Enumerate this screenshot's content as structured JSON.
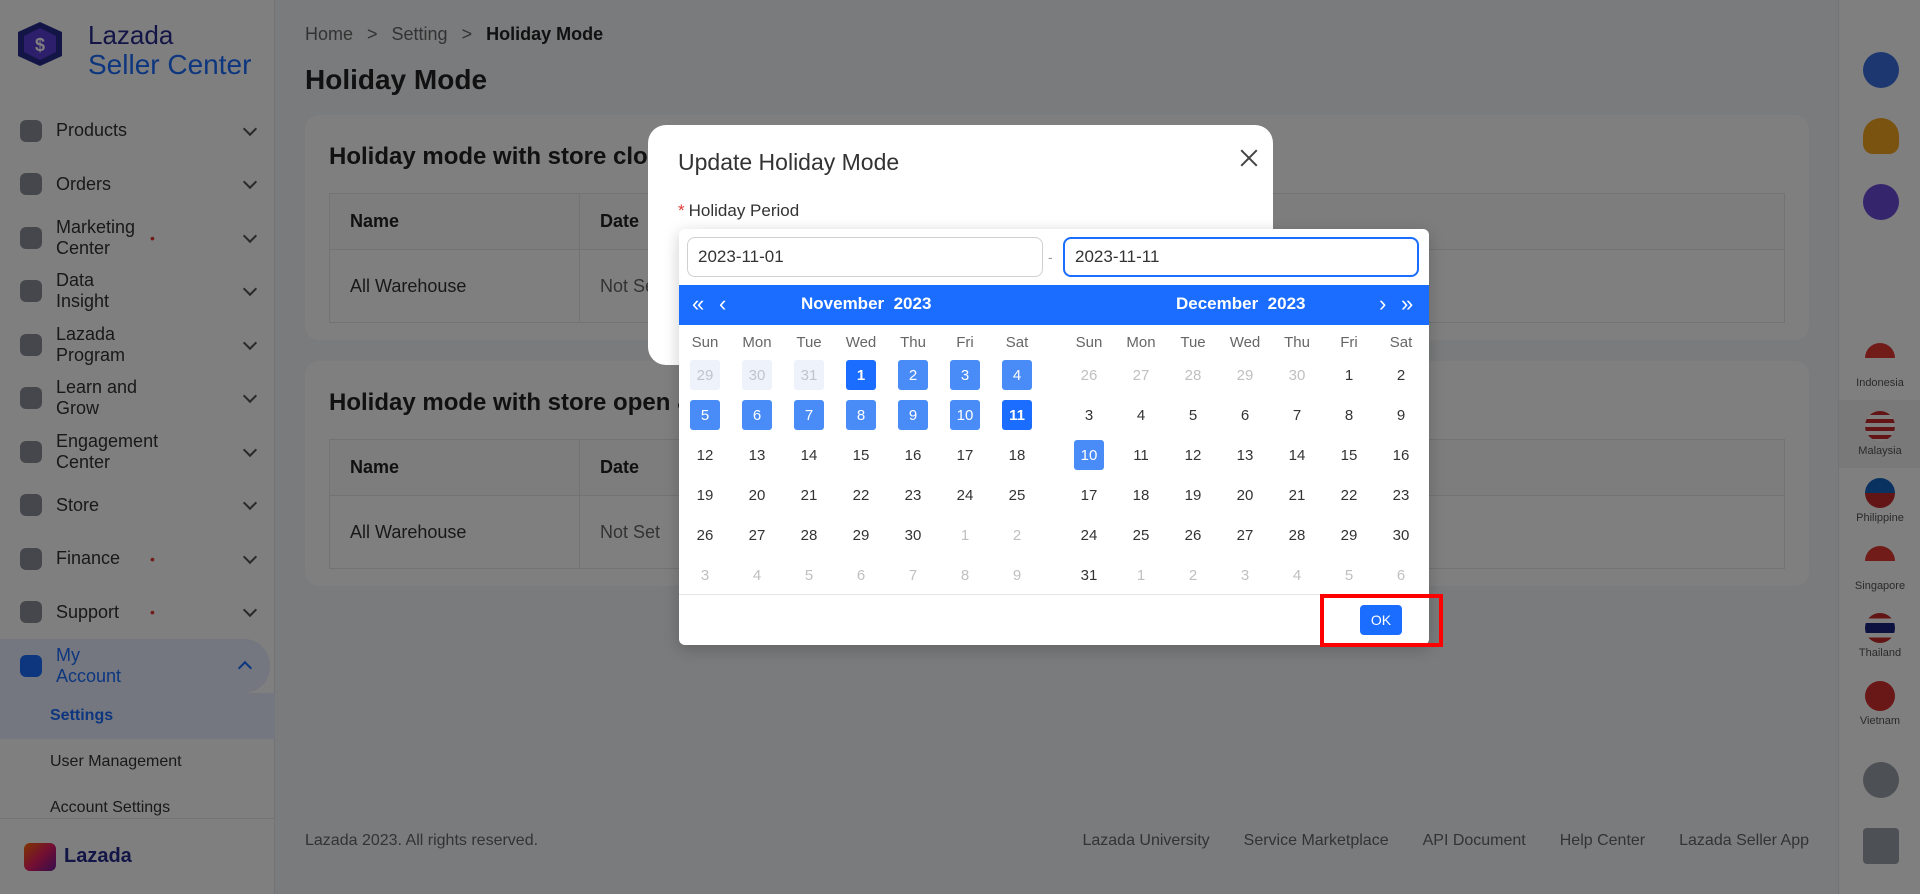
{
  "brand": {
    "line1": "Lazada",
    "line2": "Seller Center",
    "footer_logo": "Lazada",
    "logo_glyph": "$"
  },
  "sidebar": {
    "items": [
      {
        "label": "Products",
        "dot": false
      },
      {
        "label": "Orders",
        "dot": false
      },
      {
        "label": "Marketing Center",
        "dot": true
      },
      {
        "label": "Data Insight",
        "dot": false
      },
      {
        "label": "Lazada Program",
        "dot": false
      },
      {
        "label": "Learn and Grow",
        "dot": false
      },
      {
        "label": "Engagement Center",
        "dot": false
      },
      {
        "label": "Store",
        "dot": false
      },
      {
        "label": "Finance",
        "dot": true
      },
      {
        "label": "Support",
        "dot": true
      },
      {
        "label": "My Account",
        "dot": false,
        "active": true
      }
    ],
    "dot_glyph": "•",
    "sub_items": [
      "Settings",
      "User Management",
      "Account Settings"
    ]
  },
  "breadcrumb": {
    "home": "Home",
    "sep": ">",
    "setting": "Setting",
    "current": "Holiday Mode"
  },
  "page_title": "Holiday Mode",
  "cards": [
    {
      "title": "Holiday mode with store clos",
      "col_name": "Name",
      "col_date": "Date",
      "row_name": "All Warehouse",
      "row_date": "Not Se"
    },
    {
      "title": "Holiday mode with store open &",
      "col_name": "Name",
      "col_date": "Date",
      "row_name": "All Warehouse",
      "row_date": "Not Set"
    }
  ],
  "footer": {
    "copyright": "Lazada 2023. All rights reserved.",
    "links": [
      "Lazada University",
      "Service Marketplace",
      "API Document",
      "Help Center",
      "Lazada Seller App"
    ]
  },
  "countries": [
    "Indonesia",
    "Malaysia",
    "Philippine",
    "Singapore",
    "Thailand",
    "Vietnam"
  ],
  "modal": {
    "title": "Update Holiday Mode",
    "field_label": "Holiday Period",
    "required_mark": "*",
    "start_date": "2023-11-01",
    "end_date": "2023-11-11",
    "range_separator": "-"
  },
  "calendar": {
    "nav": {
      "prev_year": "«",
      "prev_month": "‹",
      "next_month": "›",
      "next_year": "»"
    },
    "weekdays": [
      "Sun",
      "Mon",
      "Tue",
      "Wed",
      "Thu",
      "Fri",
      "Sat"
    ],
    "left": {
      "month": "November",
      "year": "2023",
      "weeks": [
        [
          "29",
          "30",
          "31",
          "1",
          "2",
          "3",
          "4"
        ],
        [
          "5",
          "6",
          "7",
          "8",
          "9",
          "10",
          "11"
        ],
        [
          "12",
          "13",
          "14",
          "15",
          "16",
          "17",
          "18"
        ],
        [
          "19",
          "20",
          "21",
          "22",
          "23",
          "24",
          "25"
        ],
        [
          "26",
          "27",
          "28",
          "29",
          "30",
          "1",
          "2"
        ],
        [
          "3",
          "4",
          "5",
          "6",
          "7",
          "8",
          "9"
        ]
      ]
    },
    "right": {
      "month": "December",
      "year": "2023",
      "weeks": [
        [
          "26",
          "27",
          "28",
          "29",
          "30",
          "1",
          "2"
        ],
        [
          "3",
          "4",
          "5",
          "6",
          "7",
          "8",
          "9"
        ],
        [
          "10",
          "11",
          "12",
          "13",
          "14",
          "15",
          "16"
        ],
        [
          "17",
          "18",
          "19",
          "20",
          "21",
          "22",
          "23"
        ],
        [
          "24",
          "25",
          "26",
          "27",
          "28",
          "29",
          "30"
        ],
        [
          "31",
          "1",
          "2",
          "3",
          "4",
          "5",
          "6"
        ]
      ]
    },
    "ok_label": "OK"
  }
}
